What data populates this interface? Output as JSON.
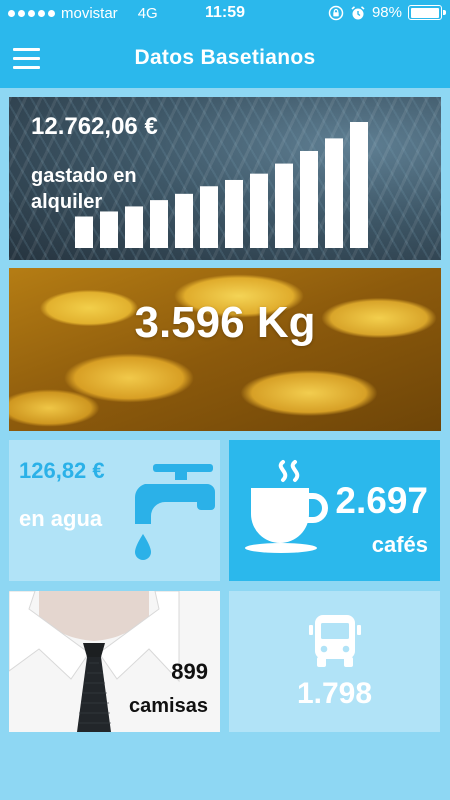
{
  "status_bar": {
    "carrier": "movistar",
    "network": "4G",
    "time": "11:59",
    "battery": "98%",
    "battery_level": 0.98,
    "signal_dots": 5
  },
  "header": {
    "title": "Datos Basetianos",
    "menu_icon": "hamburger-menu-icon"
  },
  "cards": {
    "rent": {
      "amount": "12.762,06 €",
      "label": "gastado en alquiler",
      "bar_chart_icon": "bar-chart-icon",
      "bar_levels": [
        0.25,
        0.29,
        0.33,
        0.38,
        0.43,
        0.49,
        0.54,
        0.59,
        0.67,
        0.77,
        0.87,
        1.0
      ]
    },
    "bananas": {
      "value": "3.596 Kg"
    },
    "water": {
      "amount": "126,82 €",
      "label": "en agua",
      "icon": "water-tap-icon"
    },
    "coffee": {
      "value": "2.697",
      "label": "cafés",
      "icon": "coffee-cup-icon"
    },
    "shirts": {
      "value": "899",
      "label": "camisas"
    },
    "bus": {
      "value": "1.798",
      "icon": "bus-icon"
    }
  },
  "colors": {
    "primary": "#2bb8ec",
    "light_tile": "#b1e3f7",
    "background": "#8ed7f3",
    "water_amount": "#2bb1e8"
  }
}
